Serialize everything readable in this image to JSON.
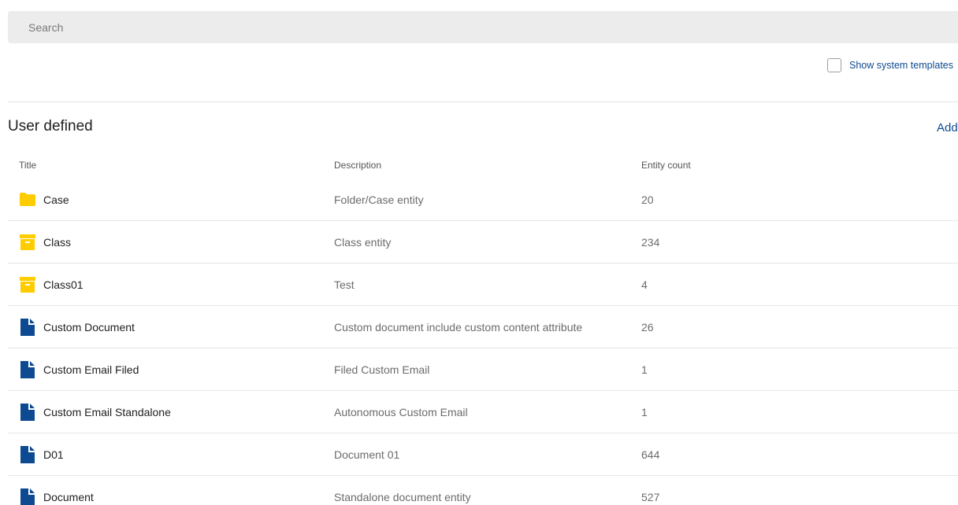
{
  "search": {
    "placeholder": "Search",
    "value": ""
  },
  "system_templates": {
    "label": "Show system templates",
    "checked": false
  },
  "section": {
    "title": "User defined",
    "add_label": "Add"
  },
  "table": {
    "headers": {
      "title": "Title",
      "description": "Description",
      "count": "Entity count"
    },
    "rows": [
      {
        "title": "Case",
        "icon": "folder-icon",
        "description": "Folder/Case entity",
        "count": "20"
      },
      {
        "title": "Class",
        "icon": "archive-box-icon",
        "description": "Class entity",
        "count": "234"
      },
      {
        "title": "Class01",
        "icon": "archive-box-icon",
        "description": "Test",
        "count": "4"
      },
      {
        "title": "Custom Document",
        "icon": "document-icon",
        "description": "Custom document include custom content attribute",
        "count": "26"
      },
      {
        "title": "Custom Email Filed",
        "icon": "document-icon",
        "description": "Filed Custom Email",
        "count": "1"
      },
      {
        "title": "Custom Email Standalone",
        "icon": "document-icon",
        "description": "Autonomous Custom Email",
        "count": "1"
      },
      {
        "title": "D01",
        "icon": "document-icon",
        "description": "Document 01",
        "count": "644"
      },
      {
        "title": "Document",
        "icon": "document-icon",
        "description": "Standalone document entity",
        "count": "527"
      }
    ]
  },
  "colors": {
    "folder": "#ffcc00",
    "document": "#0e4a91",
    "link": "#0e4a91"
  }
}
